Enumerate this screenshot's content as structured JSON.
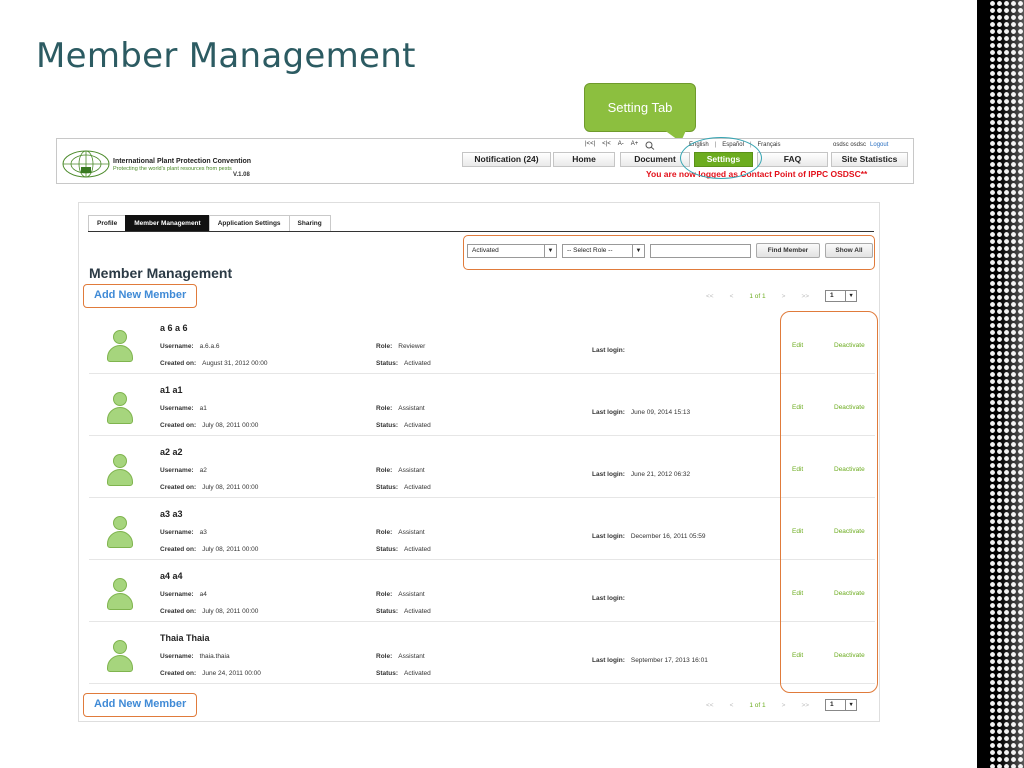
{
  "slide_title": "Member Management",
  "callout": {
    "text": "Setting Tab"
  },
  "site_header": {
    "org_name": "International Plant Protection Convention",
    "tagline": "Protecting the world's plant resources from pests",
    "version": "V.1.08",
    "util": [
      "|<<|",
      "<|<",
      "A-",
      "A+"
    ],
    "languages": [
      "English",
      "Español",
      "Français"
    ],
    "user_name": "osdsc osdsc",
    "logout": "Logout",
    "nav": [
      {
        "label": "Notification (24)"
      },
      {
        "label": "Home"
      },
      {
        "label": "Document"
      },
      {
        "label": "Settings",
        "active": true
      },
      {
        "label": "FAQ"
      },
      {
        "label": "Site Statistics"
      }
    ],
    "login_notice": "You are now logged as Contact Point of IPPC OSDSC**"
  },
  "tabs": [
    "Profile",
    "Member Management",
    "Application Settings",
    "Sharing"
  ],
  "filters": {
    "status_value": "Activated",
    "role_value": "-- Select Role --",
    "search_value": "",
    "find_label": "Find Member",
    "show_all_label": "Show All"
  },
  "section_heading": "Member Management",
  "add_member_label": "Add New Member",
  "pagination": {
    "first": "<<",
    "prev": "<",
    "current": "1 of 1",
    "next": ">",
    "last": ">>",
    "page_value": "1"
  },
  "labels": {
    "username": "Username:",
    "created": "Created on:",
    "role": "Role:",
    "status": "Status:",
    "last_login": "Last login:",
    "edit": "Edit",
    "deactivate": "Deactivate"
  },
  "members": [
    {
      "name": "a 6 a 6",
      "username": "a.6.a.6",
      "created": "August 31, 2012  00:00",
      "role": "Reviewer",
      "status": "Activated",
      "last_login": ""
    },
    {
      "name": "a1 a1",
      "username": "a1",
      "created": "July 08, 2011  00:00",
      "role": "Assistant",
      "status": "Activated",
      "last_login": "June 09, 2014  15:13"
    },
    {
      "name": "a2 a2",
      "username": "a2",
      "created": "July 08, 2011  00:00",
      "role": "Assistant",
      "status": "Activated",
      "last_login": "June 21, 2012  06:32"
    },
    {
      "name": "a3 a3",
      "username": "a3",
      "created": "July 08, 2011  00:00",
      "role": "Assistant",
      "status": "Activated",
      "last_login": "December 16, 2011  05:59"
    },
    {
      "name": "a4 a4",
      "username": "a4",
      "created": "July 08, 2011  00:00",
      "role": "Assistant",
      "status": "Activated",
      "last_login": ""
    },
    {
      "name": "Thaia Thaia",
      "username": "thaia.thaia",
      "created": "June 24, 2011  00:00",
      "role": "Assistant",
      "status": "Activated",
      "last_login": "September 17, 2013  16:01"
    }
  ],
  "colors": {
    "accent_green": "#6cac1f",
    "highlight_orange": "#e07b3b",
    "title_teal": "#2c5b62",
    "link_blue": "#3f8ad6"
  }
}
